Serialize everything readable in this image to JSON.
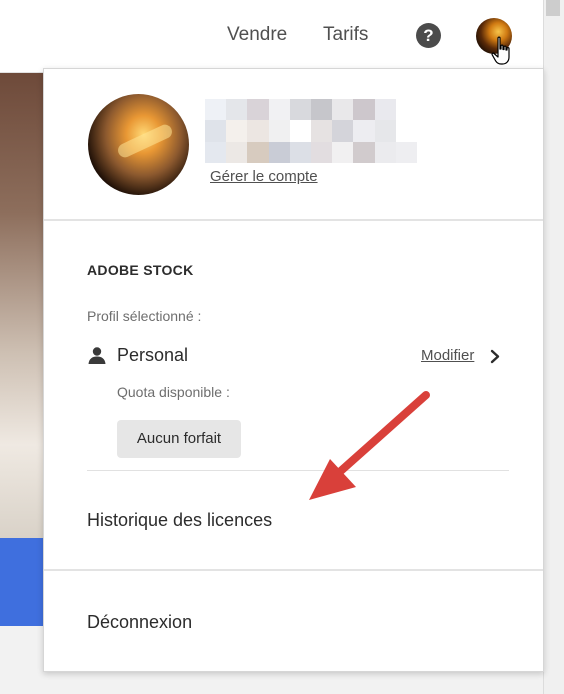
{
  "header": {
    "links": [
      "Vendre",
      "Tarifs"
    ],
    "help_icon": "question-circle-icon",
    "help_glyph": "?",
    "avatar_icon": "user-avatar-icon",
    "cursor_icon": "hand-pointer-icon"
  },
  "account": {
    "manage_label": "Gérer le compte",
    "name_redacted": true
  },
  "stock": {
    "section_title": "ADOBE STOCK",
    "profile_label": "Profil sélectionné :",
    "profile_name": "Personal",
    "profile_icon": "person-icon",
    "modify_label": "Modifier",
    "modify_icon": "chevron-right-icon",
    "quota_label": "Quota disponible :",
    "plan_badge": "Aucun forfait"
  },
  "menu": {
    "history_label": "Historique des licences",
    "logout_label": "Déconnexion"
  },
  "colors": {
    "annotation_arrow": "#d9403a",
    "background_blue": "#3f6fde",
    "text_primary": "#2c2c2c",
    "text_secondary": "#6e6e6e"
  }
}
